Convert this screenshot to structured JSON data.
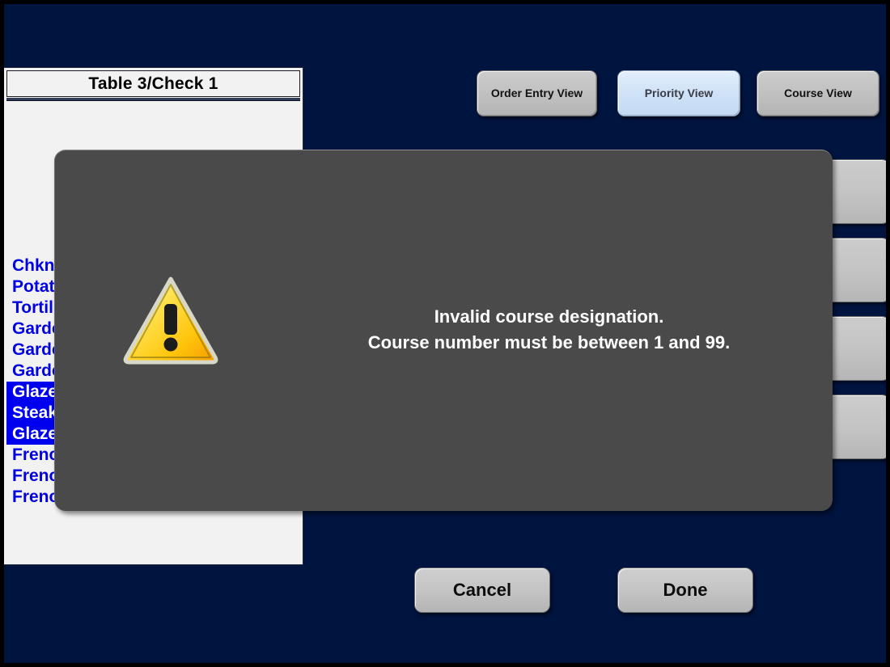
{
  "colors": {
    "desktop_background": "#001440",
    "panel_background": "#f2f2f2",
    "item_text": "#0000e2",
    "item_selected_background": "#0000ee",
    "item_selected_text": "#ffffff",
    "dialog_background": "#4a4a4a",
    "dialog_text": "#ffffff",
    "button_face": "#c4c4c4",
    "button_selected_face": "#cfe2f7",
    "warning_yellow": "#ffd21e",
    "side_button_text": "#0a7a18"
  },
  "check_panel": {
    "title": "Table 3/Check 1",
    "items": [
      {
        "label": "Chkn",
        "selected": false
      },
      {
        "label": "Potato",
        "selected": false
      },
      {
        "label": "Tortill",
        "selected": false
      },
      {
        "label": "Garde",
        "selected": false
      },
      {
        "label": "Garde",
        "selected": false
      },
      {
        "label": "Garde",
        "selected": false
      },
      {
        "label": "Glaze",
        "selected": true
      },
      {
        "label": "Steak",
        "selected": true
      },
      {
        "label": "Glaze",
        "selected": true
      },
      {
        "label": "Frenc",
        "selected": false
      },
      {
        "label": "Frenc",
        "selected": false
      },
      {
        "label": "Frenc",
        "selected": false
      }
    ]
  },
  "view_buttons": [
    {
      "label": "Order Entry View",
      "selected": false
    },
    {
      "label": "Priority View",
      "selected": true
    },
    {
      "label": "Course View",
      "selected": false
    }
  ],
  "side_buttons": [
    {
      "label": ""
    },
    {
      "label": ""
    },
    {
      "label": ""
    },
    {
      "label": ""
    }
  ],
  "bottom_buttons": {
    "cancel_label": "Cancel",
    "done_label": "Done"
  },
  "dialog": {
    "icon": "warning-triangle-icon",
    "message_line_1": "Invalid course designation.",
    "message_line_2": "Course number must be between 1 and 99."
  }
}
